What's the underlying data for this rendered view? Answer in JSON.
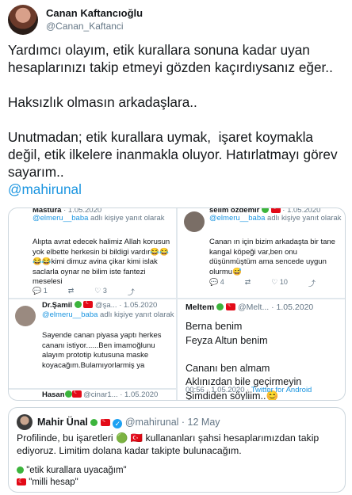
{
  "author": {
    "name": "Canan Kaftancıoğlu",
    "handle": "@Canan_Kaftanci"
  },
  "tweet": {
    "text": "Yardımcı olayım, etik kurallara sonuna kadar uyan hesaplarınızı takip etmeyi gözden kaçırdıysanız eğer..\n\nHaksızlık olmasın arkadaşlara..\n\nUnutmadan; etik kurallara uymak,  işaret koymakla değil, etik ilkelere inanmakla oluyor. Hatırlatmayı görev sayarım..",
    "mention": "@mahirunal"
  },
  "media": {
    "p1": {
      "header": "Mastura",
      "date": "1.05.2020",
      "reply_prefix": "@elmeru__baba",
      "reply_suffix": " adlı kişiye yanıt olarak",
      "body": "Alıpta avrat edecek halimiz Allah korusun yok elbette herkesin bi bildigi vardır😂😂😂😂kimi dimuz avina çikar kimi islak saclarla oynar ne bilim iste fantezi meselesi",
      "counts": [
        "1",
        "",
        "3",
        ""
      ]
    },
    "p2": {
      "header": "selim özdemir",
      "date": "1.05.2020",
      "reply_prefix": "@elmeru__baba",
      "reply_suffix": " adlı kişiye yanıt olarak",
      "body": "Canan ın için bizim arkadaşta bir tane kangal köpeği var,ben onu düşünmüştüm ama sencede uygun olurmu😅",
      "counts": [
        "4",
        "",
        "10",
        ""
      ]
    },
    "p3": {
      "header": "Dr.Şamil",
      "handle": "@şa...",
      "date": "1.05.2020",
      "reply_prefix": "@elmeru__baba",
      "reply_suffix": " adlı kişiye yanıt olarak",
      "body": "Sayende canan piyasa yaptı herkes cananı istiyor......Ben imamoğlunu alayım prototip kutusuna maske koyacağım.Bulamıyorlarmiş ya"
    },
    "p4": {
      "name": "Meltem",
      "handle": "@Melt...",
      "date": "1.05.2020",
      "body": "Berna benim\nFeyza Altun benim\n\nCananı ben almam\nAklınızdan bile geçirmeyin\nŞimdiden söyliim..😊",
      "time": "00:56",
      "date2": "1.05.2020",
      "source": "Twitter for Android"
    },
    "p5": {
      "name": "Hasan",
      "handle": "@cinar1...",
      "date": "1.05.2020"
    }
  },
  "quote": {
    "name": "Mahir Ünal",
    "handle": "@mahirunal",
    "date": "12 May",
    "body": "Profilinde, bu işaretleri 🟢 🇹🇷  kullananları şahsi hesaplarımızdan takip ediyoruz. Limitim dolana kadar takipte bulunacağım.",
    "legend_green": "\"etik kurallara uyacağım\"",
    "legend_flag": "\"milli hesap\""
  },
  "colors": {
    "link": "#1b95e0",
    "secondary": "#657786",
    "border": "#ccd6dd",
    "verified": "#1da1f2"
  }
}
